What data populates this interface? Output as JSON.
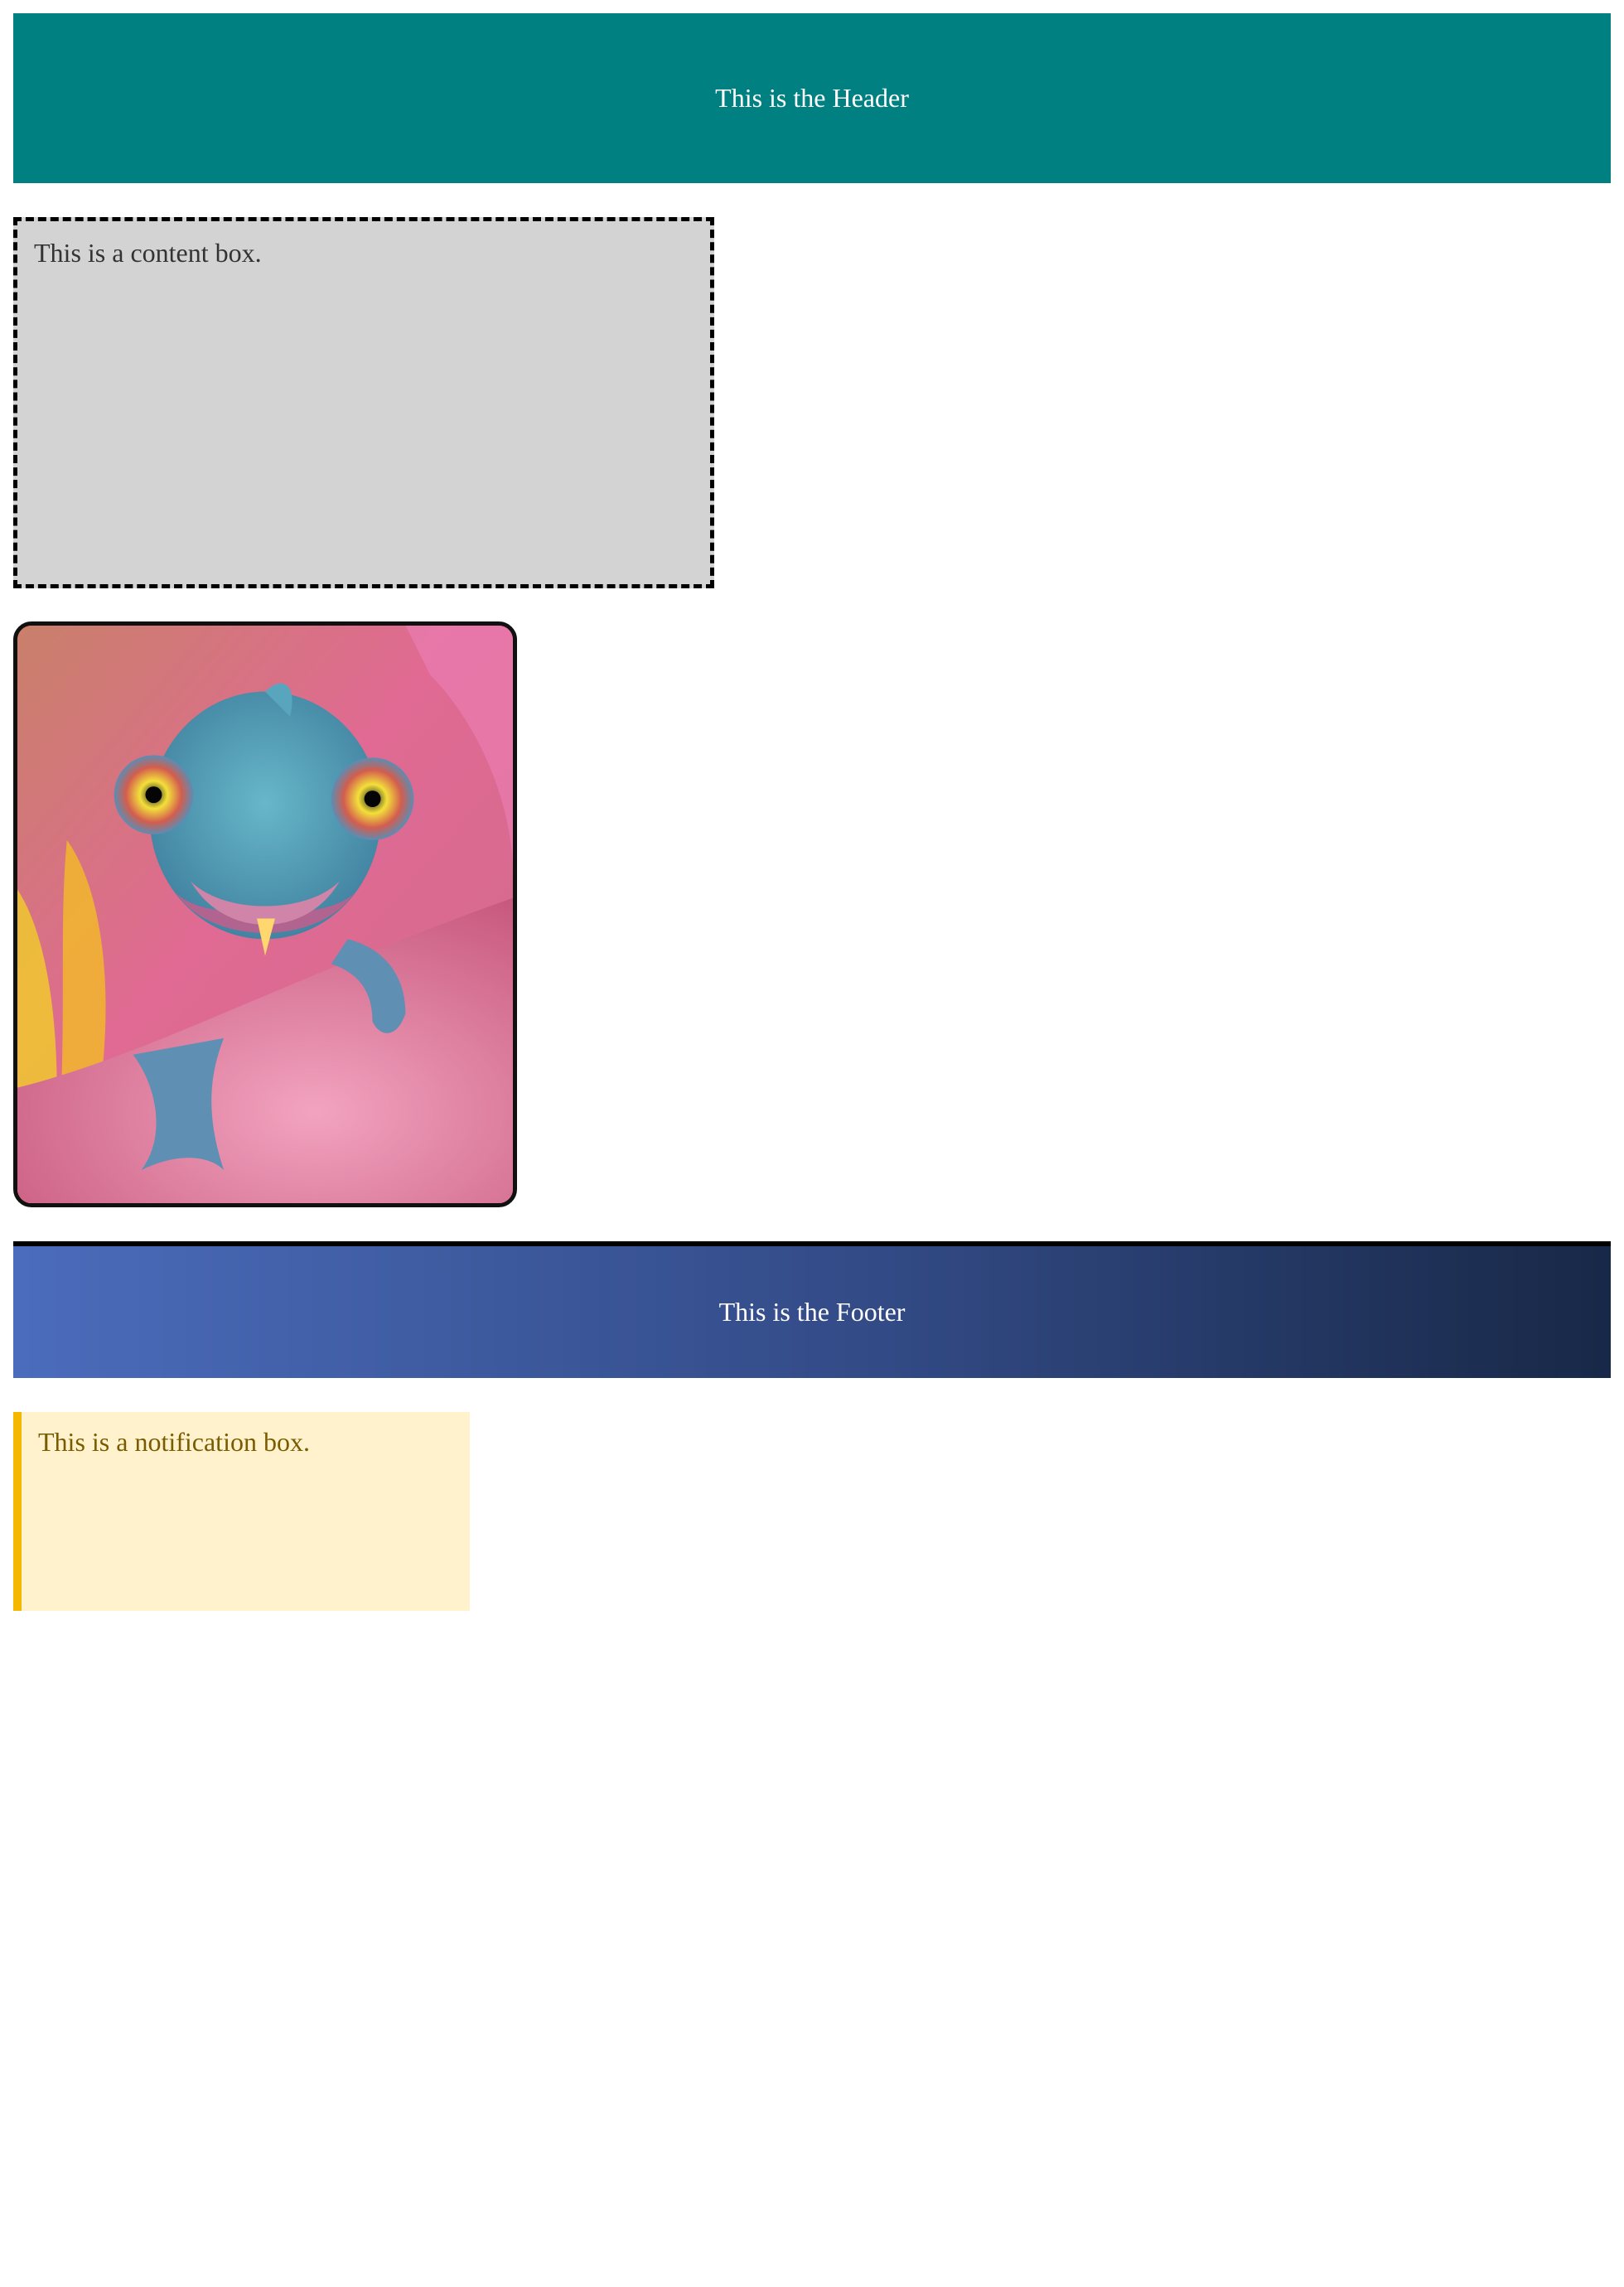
{
  "header": {
    "text": "This is the Header",
    "background_color": "#008080"
  },
  "content_box": {
    "text": "This is a content box.",
    "background_color": "#d3d3d3"
  },
  "image_card": {
    "subject": "chameleon-photo"
  },
  "footer": {
    "text": "This is the Footer",
    "gradient_start": "#4b6cbc",
    "gradient_end": "#182847"
  },
  "notification": {
    "text": "This is a notification box.",
    "background_color": "#fff2cc",
    "accent_color": "#f5b800"
  }
}
